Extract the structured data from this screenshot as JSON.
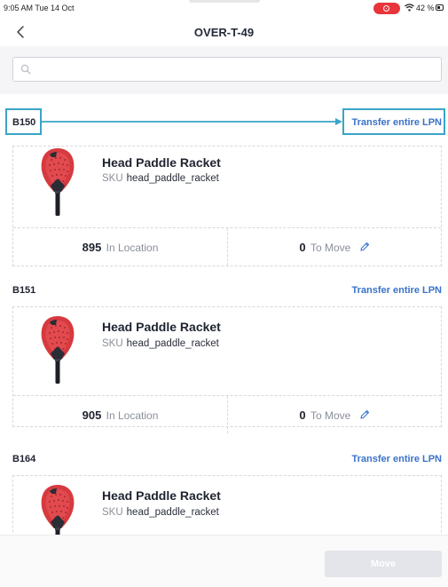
{
  "status_bar": {
    "time": "9:05 AM  Tue 14 Oct",
    "battery": "42 %",
    "icons": [
      "record-icon",
      "wifi-icon",
      "battery-icon"
    ]
  },
  "nav": {
    "title": "OVER-T-49",
    "back_icon": "chevron-left-icon"
  },
  "search": {
    "placeholder": "",
    "value": "",
    "icon": "search-icon"
  },
  "colors": {
    "link": "#3a72c8",
    "highlight": "#3aa4c8",
    "disabled_button": "#e3e5ea",
    "racket_red": "#d63a3f"
  },
  "lpns": [
    {
      "code": "B150",
      "transfer_label": "Transfer entire LPN",
      "product_name": "Head Paddle Racket",
      "sku_label": "SKU",
      "sku": "head_paddle_racket",
      "in_location_qty": "895",
      "in_location_label": "In Location",
      "to_move_qty": "0",
      "to_move_label": "To Move"
    },
    {
      "code": "B151",
      "transfer_label": "Transfer entire LPN",
      "product_name": "Head Paddle Racket",
      "sku_label": "SKU",
      "sku": "head_paddle_racket",
      "in_location_qty": "905",
      "in_location_label": "In Location",
      "to_move_qty": "0",
      "to_move_label": "To Move"
    },
    {
      "code": "B164",
      "transfer_label": "Transfer entire LPN",
      "product_name": "Head Paddle Racket",
      "sku_label": "SKU",
      "sku": "head_paddle_racket"
    }
  ],
  "footer": {
    "move_label": "Move",
    "move_enabled": false
  }
}
